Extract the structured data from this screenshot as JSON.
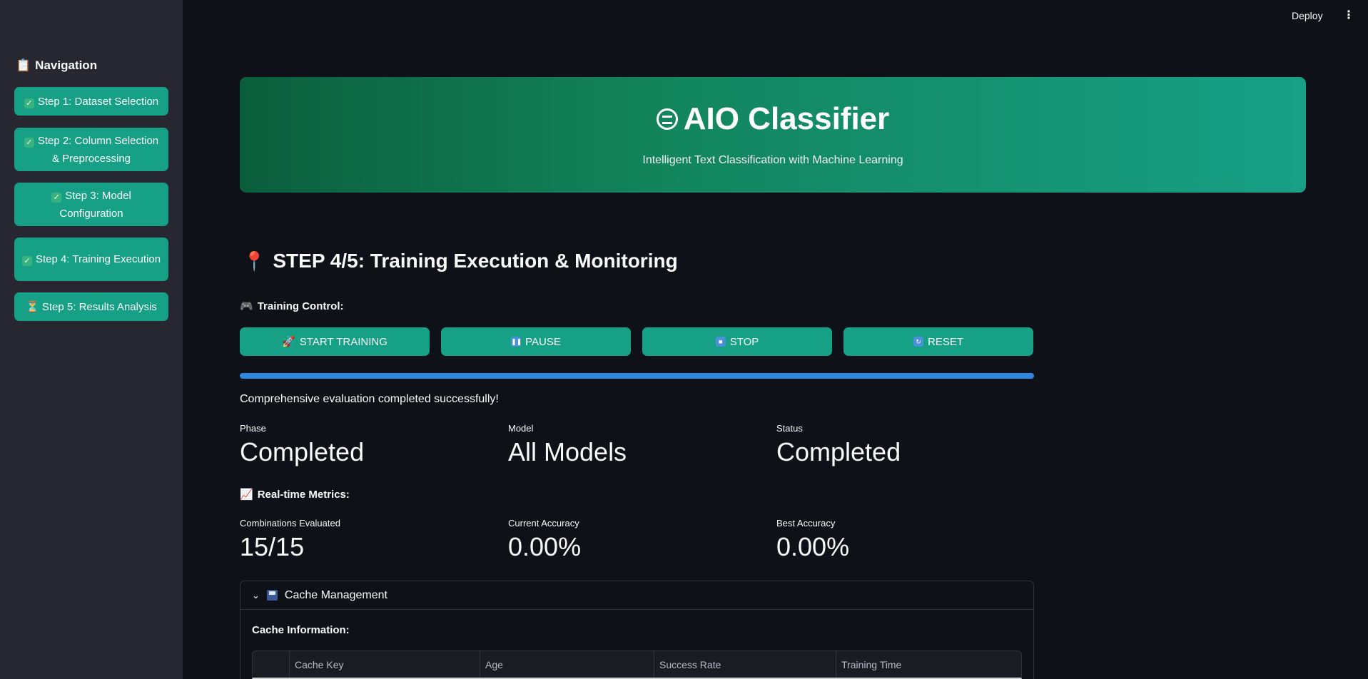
{
  "sidebar": {
    "title": "Navigation",
    "title_icon": "clipboard-icon",
    "items": [
      {
        "label": "Step 1: Dataset Selection",
        "icon": "check-icon"
      },
      {
        "label": "Step 2: Column Selection & Preprocessing",
        "icon": "check-icon"
      },
      {
        "label": "Step 3: Model Configuration",
        "icon": "check-icon"
      },
      {
        "label": "Step 4: Training Execution",
        "icon": "check-icon"
      },
      {
        "label": "Step 5: Results Analysis",
        "icon": "hourglass-icon"
      }
    ]
  },
  "topbar": {
    "deploy_label": "Deploy",
    "menu_icon": "more-vertical-icon"
  },
  "hero": {
    "title": "AIO Classifier",
    "title_icon": "robot-icon",
    "subtitle": "Intelligent Text Classification with Machine Learning"
  },
  "step_heading": "STEP 4/5: Training Execution & Monitoring",
  "training_control": {
    "label": "Training Control:",
    "buttons": [
      {
        "label": "START TRAINING",
        "icon": "rocket-icon"
      },
      {
        "label": "PAUSE",
        "icon": "pause-icon"
      },
      {
        "label": "STOP",
        "icon": "stop-icon"
      },
      {
        "label": "RESET",
        "icon": "reset-icon"
      }
    ]
  },
  "progress": {
    "value": 1.0
  },
  "status_message": "Comprehensive evaluation completed successfully!",
  "status_metrics": [
    {
      "label": "Phase",
      "value": "Completed"
    },
    {
      "label": "Model",
      "value": "All Models"
    },
    {
      "label": "Status",
      "value": "Completed"
    }
  ],
  "realtime": {
    "label": "Real-time Metrics:",
    "metrics": [
      {
        "label": "Combinations Evaluated",
        "value": "15/15"
      },
      {
        "label": "Current Accuracy",
        "value": "0.00%"
      },
      {
        "label": "Best Accuracy",
        "value": "0.00%"
      }
    ]
  },
  "cache": {
    "header": "Cache Management",
    "info_label": "Cache Information:",
    "columns": [
      "",
      "Cache Key",
      "Age",
      "Success Rate",
      "Training Time"
    ]
  },
  "colors": {
    "accent": "#16a085",
    "progress": "#2e86de",
    "background": "#0e1117",
    "sidebar": "#262730"
  }
}
